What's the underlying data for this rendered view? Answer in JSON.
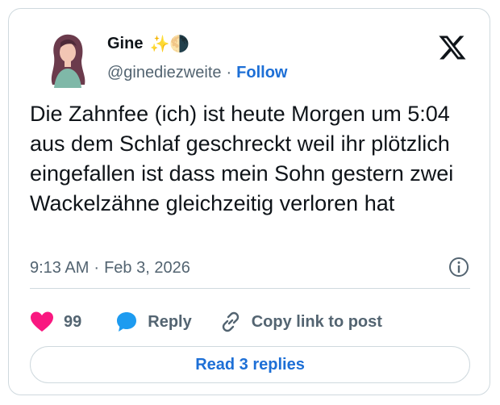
{
  "author": {
    "name": "Gine",
    "emoji": "✨🌗",
    "handle": "@ginediezweite",
    "separator": "·",
    "follow_label": "Follow"
  },
  "tweet": {
    "text": "Die Zahnfee (ich) ist heute Morgen um 5:04 aus dem Schlaf geschreckt weil ihr plötzlich eingefallen ist dass mein Sohn gestern zwei Wackelzähne gleichzeitig verloren hat",
    "time": "9:13 AM",
    "separator": "·",
    "date": "Feb 3, 2026"
  },
  "actions": {
    "like_count": "99",
    "reply_label": "Reply",
    "copy_label": "Copy link to post"
  },
  "replies_button": "Read 3 replies",
  "icons": {
    "brand": "x-logo-icon",
    "info": "info-icon",
    "like": "heart-icon",
    "reply": "speech-bubble-icon",
    "copy": "link-icon"
  },
  "colors": {
    "accent": "#1d6fd6",
    "like": "#f91880",
    "reply_icon": "#1d9bf0",
    "muted": "#536471"
  }
}
